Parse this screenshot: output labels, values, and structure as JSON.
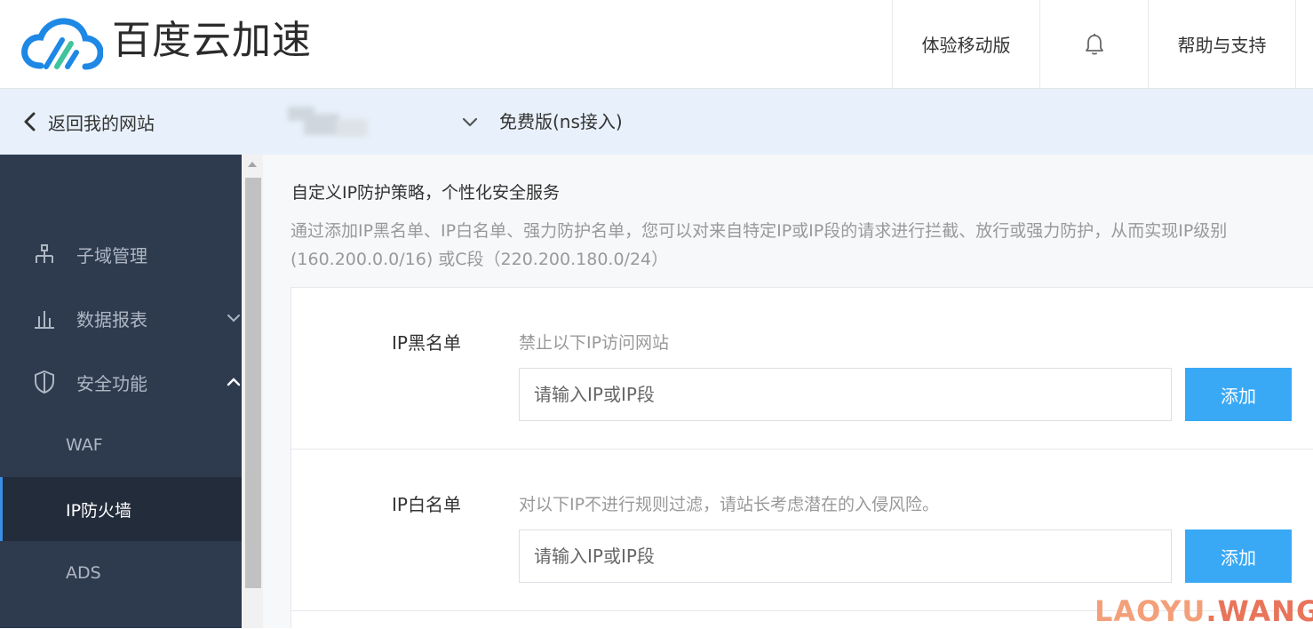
{
  "header": {
    "brand": "百度云加速",
    "nav": {
      "mobile": "体验移动版",
      "help": "帮助与支持"
    }
  },
  "subbar": {
    "back_label": "返回我的网站",
    "plan": "免费版(ns接入)"
  },
  "sidebar": {
    "items": [
      {
        "label": "子域管理",
        "icon": "subdomain-icon"
      },
      {
        "label": "数据报表",
        "icon": "chart-icon",
        "expanded": false
      },
      {
        "label": "安全功能",
        "icon": "shield-icon",
        "expanded": true
      }
    ],
    "security_sub": [
      {
        "label": "WAF",
        "active": false
      },
      {
        "label": "IP防火墙",
        "active": true
      },
      {
        "label": "ADS",
        "active": false
      }
    ]
  },
  "main": {
    "intro_title": "自定义IP防护策略，个性化安全服务",
    "intro_desc_line1": "通过添加IP黑名单、IP白名单、强力防护名单，您可以对来自特定IP或IP段的请求进行拦截、放行或强力防护，从而实现IP级别",
    "intro_desc_line2": "(160.200.0.0/16) 或C段（220.200.180.0/24）",
    "blacklist": {
      "name": "IP黑名单",
      "desc": "禁止以下IP访问网站",
      "placeholder": "请输入IP或IP段",
      "button": "添加"
    },
    "whitelist": {
      "name": "IP白名单",
      "desc": "对以下IP不进行规则过滤，请站长考虑潜在的入侵风险。",
      "placeholder": "请输入IP或IP段",
      "button": "添加"
    }
  },
  "watermark": {
    "part1": "LAOYU",
    "part2": ".WANG"
  },
  "colors": {
    "sidebar_bg": "#2e3b4f",
    "subbar_bg": "#e8f1fb",
    "button_blue": "#3aa9f5",
    "logo_blue": "#1e88e5",
    "logo_green": "#3fc49b"
  }
}
